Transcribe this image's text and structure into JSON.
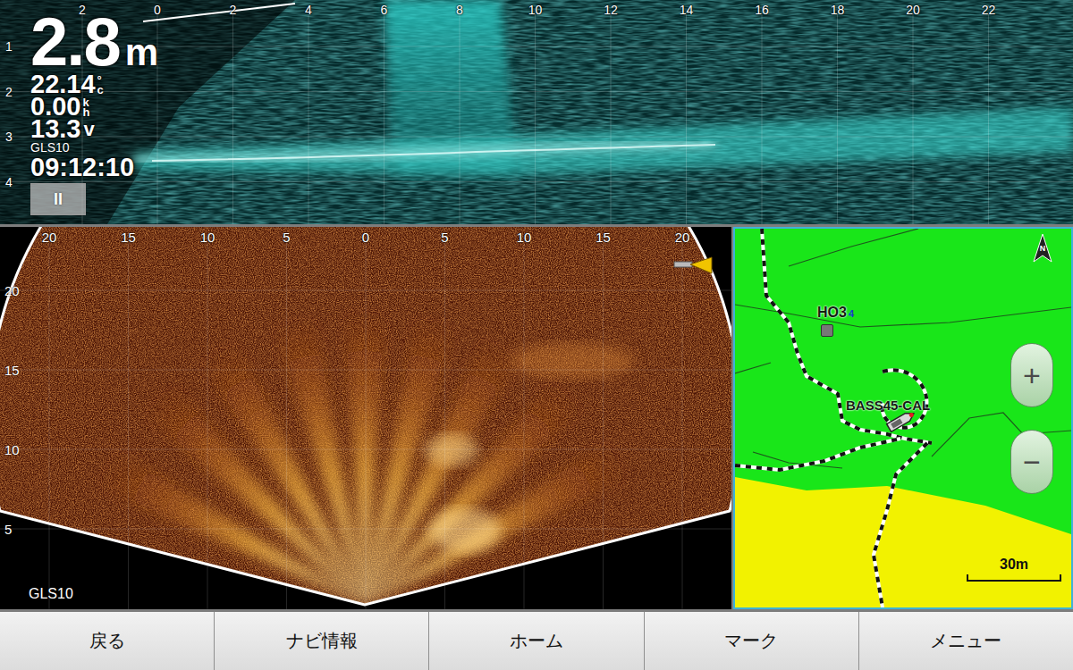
{
  "sonar": {
    "depth": "2.8",
    "depth_unit": "m",
    "temperature": "22.14",
    "temperature_unit_top": "°",
    "temperature_unit_bottom": "c",
    "speed": "0.00",
    "speed_unit_top": "k",
    "speed_unit_bottom": "h",
    "voltage": "13.3",
    "voltage_unit": "v",
    "source": "GLS10",
    "time": "09:12:10",
    "pause_button": "II",
    "range_ticks": [
      "2",
      "0",
      "2",
      "4",
      "6",
      "8",
      "10",
      "12",
      "14",
      "16",
      "18",
      "20",
      "22"
    ],
    "depth_ticks": [
      "1",
      "2",
      "3",
      "4"
    ]
  },
  "scan": {
    "range_ticks": [
      "20",
      "15",
      "10",
      "5",
      "0",
      "5",
      "10",
      "15",
      "20"
    ],
    "distance_ticks": [
      "20",
      "15",
      "10",
      "5"
    ],
    "source": "GLS10"
  },
  "map": {
    "waypoints": [
      {
        "label": "HO3",
        "sub": "4"
      }
    ],
    "boat_label": "BASS45-CAL",
    "north": "N",
    "zoom_in": "+",
    "zoom_out": "−",
    "scale": "30m"
  },
  "toolbar": {
    "buttons": [
      "戻る",
      "ナビ情報",
      "ホーム",
      "マーク",
      "メニュー"
    ]
  }
}
